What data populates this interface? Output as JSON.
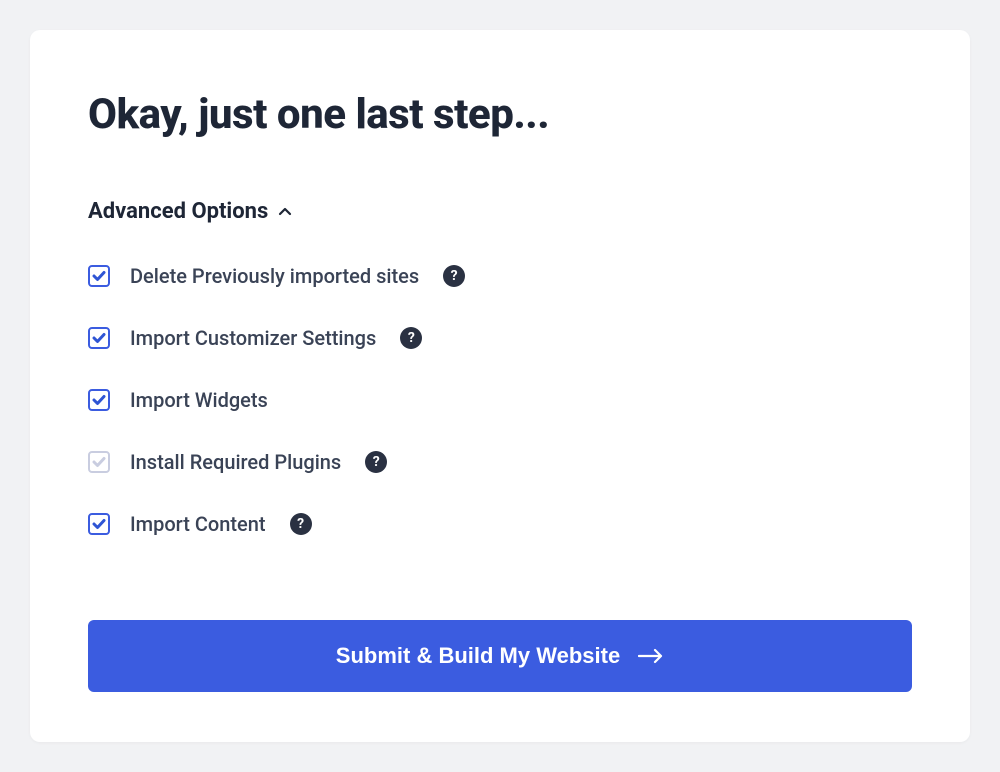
{
  "title": "Okay, just one last step...",
  "section": {
    "title": "Advanced Options",
    "expanded": true
  },
  "options": [
    {
      "label": "Delete Previously imported sites",
      "checked": true,
      "disabled": false,
      "help": true
    },
    {
      "label": "Import Customizer Settings",
      "checked": true,
      "disabled": false,
      "help": true
    },
    {
      "label": "Import Widgets",
      "checked": true,
      "disabled": false,
      "help": false
    },
    {
      "label": "Install Required Plugins",
      "checked": true,
      "disabled": true,
      "help": true
    },
    {
      "label": "Import Content",
      "checked": true,
      "disabled": false,
      "help": true
    }
  ],
  "submit_label": "Submit & Build My Website",
  "help_glyph": "?"
}
